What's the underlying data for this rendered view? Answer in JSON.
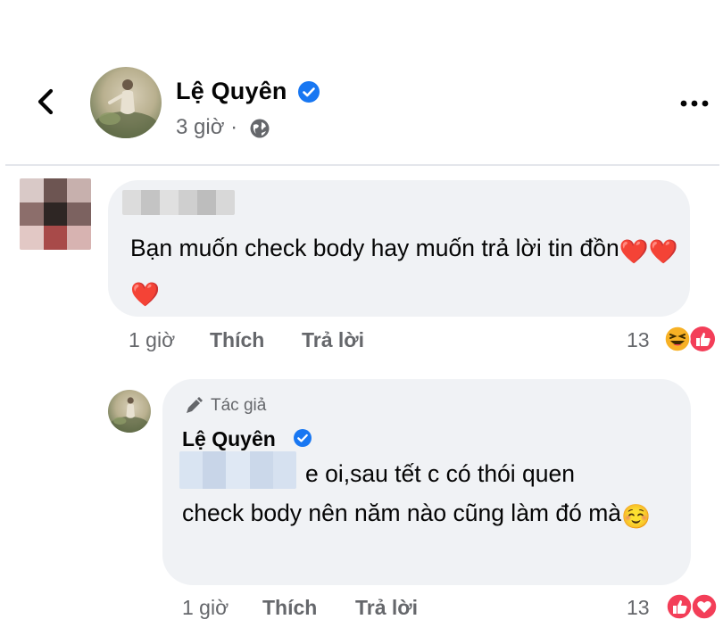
{
  "post": {
    "author": "Lệ Quyên",
    "time": "3 giờ ·",
    "icons": {
      "back": "chevron-left-icon",
      "verified": "verified-badge-icon",
      "audience": "globe-icon",
      "more": "more-horizontal-icon"
    }
  },
  "comment": {
    "text_main": "Bạn muốn check body hay muốn trả lời tin đồn",
    "emoji": [
      "❤️",
      "❤️",
      "❤️"
    ],
    "time": "1 giờ",
    "like_label": "Thích",
    "reply_label": "Trả lời",
    "reaction_count": "13",
    "reactions": [
      "haha",
      "like"
    ]
  },
  "reply": {
    "badge": "Tác giả",
    "author": "Lệ Quyên",
    "line1": "e oi,sau tết c có thói quen",
    "rest": "check body nên năm nào cũng làm đó mà",
    "emoji": "☺️",
    "time": "1 giờ",
    "like_label": "Thích",
    "reply_label": "Trả lời",
    "reaction_count": "13",
    "reactions": [
      "like",
      "love"
    ]
  },
  "colors": {
    "bubble": "#f0f2f5",
    "meta_gray": "#65676b",
    "verified_blue": "#1877f2",
    "like_blue": "#1877f2",
    "love_red": "#f33e58",
    "haha_yellow": "#f7b125"
  }
}
